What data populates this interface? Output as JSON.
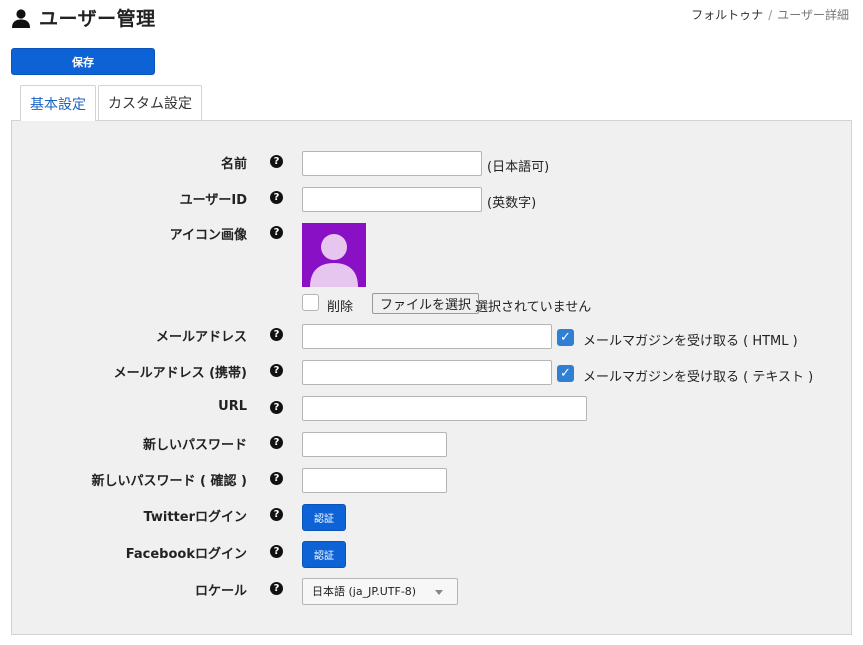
{
  "header": {
    "title": "ユーザー管理",
    "icon": "user-icon"
  },
  "breadcrumb": {
    "parent": "フォルトゥナ",
    "separator": "/",
    "current": "ユーザー詳細"
  },
  "toolbar": {
    "save_label": "保存"
  },
  "tabs": [
    {
      "label": "基本設定",
      "active": true
    },
    {
      "label": "カスタム設定",
      "active": false
    }
  ],
  "form": {
    "help_glyph": "?",
    "name": {
      "label": "名前",
      "value": "",
      "note": "(日本語可)"
    },
    "user_id": {
      "label": "ユーザーID",
      "value": "",
      "note": "(英数字)"
    },
    "icon_image": {
      "label": "アイコン画像",
      "delete_label": "削除",
      "delete_checked": false,
      "file_button": "ファイルを選択",
      "file_status": "選択されていません",
      "avatar_color": "#8a10c6"
    },
    "email": {
      "label": "メールアドレス",
      "value": "",
      "newsletter_label": "メールマガジンを受け取る ( HTML )",
      "newsletter_checked": true
    },
    "email_mobile": {
      "label": "メールアドレス (携帯)",
      "value": "",
      "newsletter_label": "メールマガジンを受け取る ( テキスト )",
      "newsletter_checked": true
    },
    "url": {
      "label": "URL",
      "value": ""
    },
    "new_password": {
      "label": "新しいパスワード",
      "value": ""
    },
    "new_password_confirm": {
      "label": "新しいパスワード ( 確認 )",
      "value": ""
    },
    "twitter_login": {
      "label": "Twitterログイン",
      "button": "認証"
    },
    "facebook_login": {
      "label": "Facebookログイン",
      "button": "認証"
    },
    "locale": {
      "label": "ロケール",
      "selected": "日本語 (ja_JP.UTF-8)"
    }
  },
  "colors": {
    "accent": "#0d63d6",
    "tab_active_text": "#1a64c4",
    "panel_bg": "#f0f0f0",
    "checkbox_on": "#2f7fd4"
  }
}
